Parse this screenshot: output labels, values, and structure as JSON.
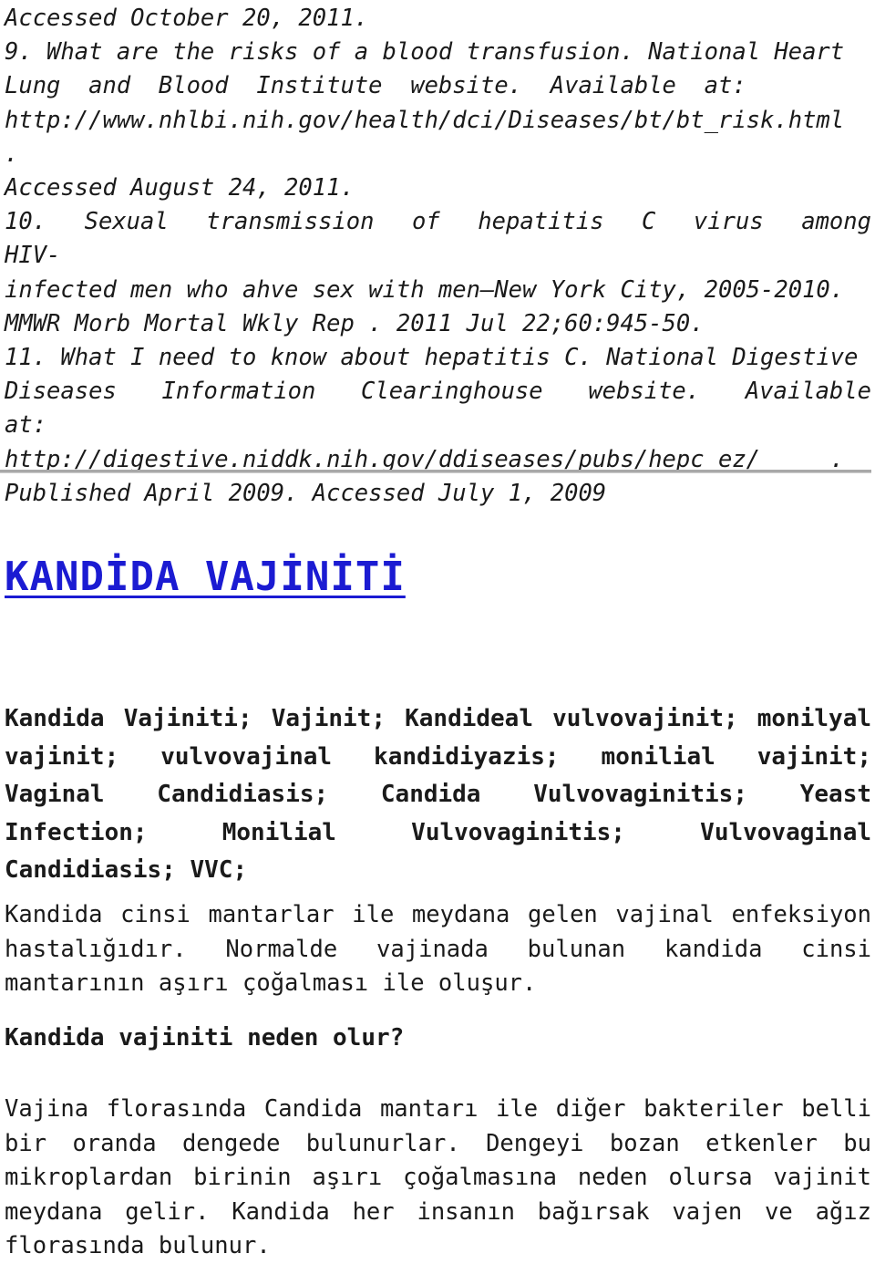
{
  "document": {
    "colors": {
      "title_blue": "#1b1bd2",
      "rule_gray": "#a8a8a8",
      "body_text": "#1a1a1a",
      "page_background": "#ffffff"
    },
    "references_block": {
      "lines": [
        "Accessed October 20, 2011.",
        "9. What are the risks of a blood transfusion. National Heart",
        "Lung  and  Blood  Institute  website.  Available  at:",
        "http://www.nhlbi.nih.gov/health/dci/Diseases/bt/bt_risk.html .",
        "Accessed August 24, 2011.",
        "10.  Sexual  transmission  of  hepatitis  C  virus  among  HIV-",
        "infected men who ahve sex with men—New York City, 2005-2010.",
        "MMWR Morb Mortal Wkly Rep . 2011 Jul 22;60:945-50.",
        "11. What I need to know about hepatitis C. National Digestive",
        "Diseases  Information  Clearinghouse  website.  Available  at:",
        "http://digestive.niddk.nih.gov/ddiseases/pubs/hepc_ez/     .",
        "Published April 2009. Accessed July 1, 2009"
      ]
    },
    "divider": {
      "label": "horizontal-rule"
    },
    "title": {
      "text": "KANDİDA VAJİNİTİ"
    },
    "synonyms": {
      "text": "Kandida Vajiniti; Vajinit; Kandideal vulvovajinit; monilyal vajinit; vulvovajinal kandidiyazis; monilial vajinit; Vaginal Candidiasis; Candida Vulvovaginitis; Yeast Infection; Monilial Vulvovaginitis; Vulvovaginal Candidiasis; VVC;"
    },
    "intro_paragraph": {
      "text": "Kandida cinsi mantarlar ile meydana gelen vajinal enfeksiyon hastalığıdır. Normalde vajinada bulunan kandida cinsi mantarının aşırı çoğalması ile oluşur."
    },
    "subheading": {
      "text": "Kandida vajiniti neden olur?"
    },
    "cause_paragraph": {
      "text": "Vajina florasında Candida mantarı ile diğer bakteriler belli bir oranda dengede bulunurlar. Dengeyi bozan etkenler bu mikroplardan birinin aşırı çoğalmasına neden olursa vajinit meydana gelir. Kandida her insanın bağırsak vajen ve ağız florasında bulunur."
    }
  }
}
